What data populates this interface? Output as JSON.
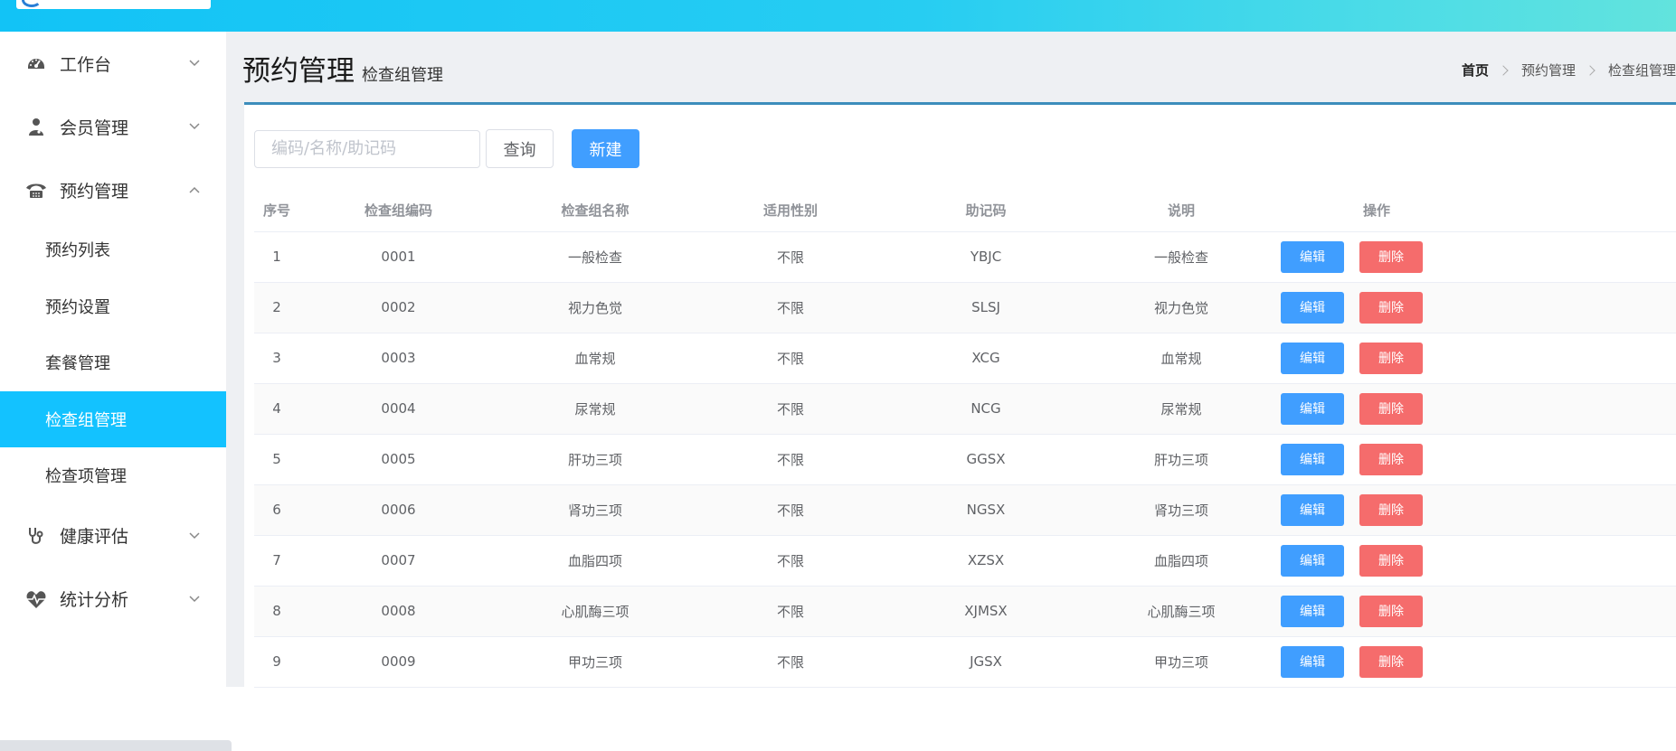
{
  "colors": {
    "accent": "#13c2ff",
    "primary": "#409eff",
    "danger": "#f56c6c"
  },
  "sidebar": {
    "groups": [
      {
        "label": "工作台",
        "icon": "dashboard-icon",
        "expanded": false
      },
      {
        "label": "会员管理",
        "icon": "user-doctor-icon",
        "expanded": false
      },
      {
        "label": "预约管理",
        "icon": "phone-icon",
        "expanded": true
      },
      {
        "label": "健康评估",
        "icon": "stethoscope-icon",
        "expanded": false
      },
      {
        "label": "统计分析",
        "icon": "heartbeat-icon",
        "expanded": false
      }
    ],
    "sub_items": [
      "预约列表",
      "预约设置",
      "套餐管理",
      "检查组管理",
      "检查项管理"
    ],
    "active_sub": "检查组管理"
  },
  "header": {
    "title": "预约管理",
    "subtitle": "检查组管理"
  },
  "breadcrumb": [
    "首页",
    "预约管理",
    "检查组管理"
  ],
  "toolbar": {
    "search_placeholder": "编码/名称/助记码",
    "query_label": "查询",
    "new_label": "新建"
  },
  "table": {
    "columns": [
      "序号",
      "检查组编码",
      "检查组名称",
      "适用性别",
      "助记码",
      "说明",
      "操作"
    ],
    "rows": [
      [
        "1",
        "0001",
        "一般检查",
        "不限",
        "YBJC",
        "一般检查"
      ],
      [
        "2",
        "0002",
        "视力色觉",
        "不限",
        "SLSJ",
        "视力色觉"
      ],
      [
        "3",
        "0003",
        "血常规",
        "不限",
        "XCG",
        "血常规"
      ],
      [
        "4",
        "0004",
        "尿常规",
        "不限",
        "NCG",
        "尿常规"
      ],
      [
        "5",
        "0005",
        "肝功三项",
        "不限",
        "GGSX",
        "肝功三项"
      ],
      [
        "6",
        "0006",
        "肾功三项",
        "不限",
        "NGSX",
        "肾功三项"
      ],
      [
        "7",
        "0007",
        "血脂四项",
        "不限",
        "XZSX",
        "血脂四项"
      ],
      [
        "8",
        "0008",
        "心肌酶三项",
        "不限",
        "XJMSX",
        "心肌酶三项"
      ],
      [
        "9",
        "0009",
        "甲功三项",
        "不限",
        "JGSX",
        "甲功三项"
      ]
    ],
    "edit_label": "编辑",
    "delete_label": "删除"
  }
}
